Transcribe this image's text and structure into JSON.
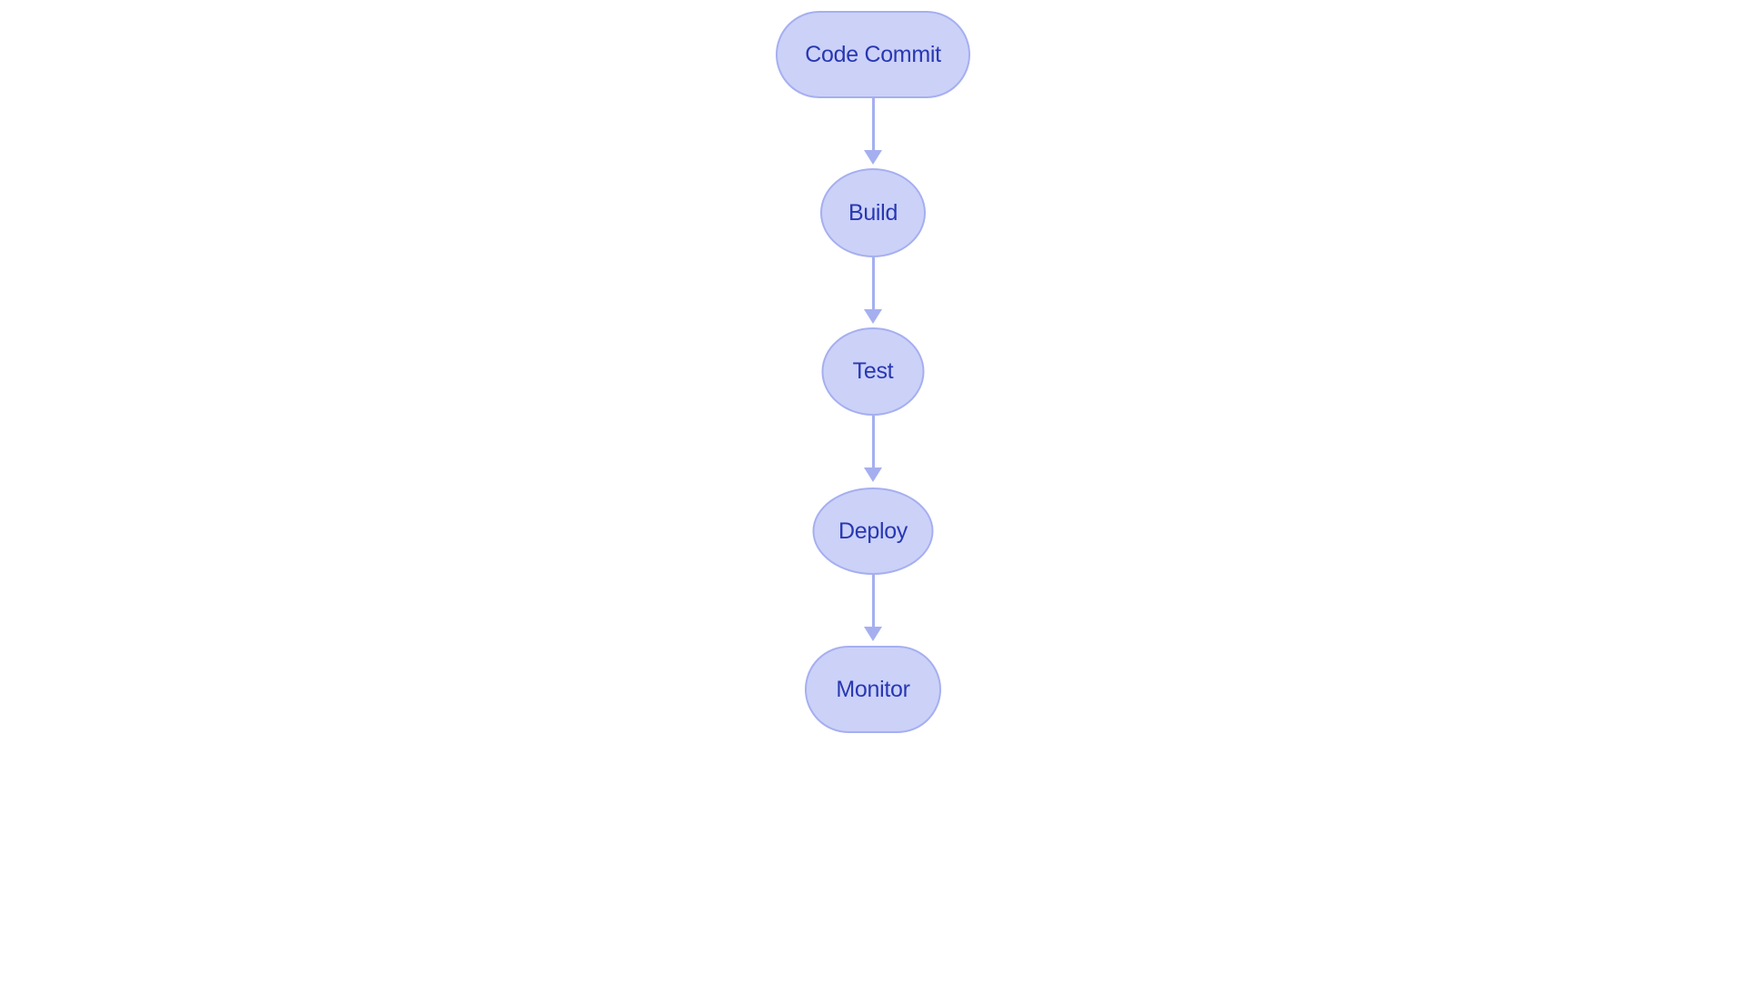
{
  "nodes": [
    {
      "id": "code-commit",
      "label": "Code Commit",
      "shape": "stadium"
    },
    {
      "id": "build",
      "label": "Build",
      "shape": "ellipse"
    },
    {
      "id": "test",
      "label": "Test",
      "shape": "ellipse"
    },
    {
      "id": "deploy",
      "label": "Deploy",
      "shape": "ellipse"
    },
    {
      "id": "monitor",
      "label": "Monitor",
      "shape": "stadium"
    }
  ],
  "edges": [
    {
      "from": "code-commit",
      "to": "build"
    },
    {
      "from": "build",
      "to": "test"
    },
    {
      "from": "test",
      "to": "deploy"
    },
    {
      "from": "deploy",
      "to": "monitor"
    }
  ],
  "colors": {
    "node_fill": "#ccd1f8",
    "node_border": "#a5aff0",
    "node_text": "#2838b2",
    "arrow": "#a5aff0"
  }
}
